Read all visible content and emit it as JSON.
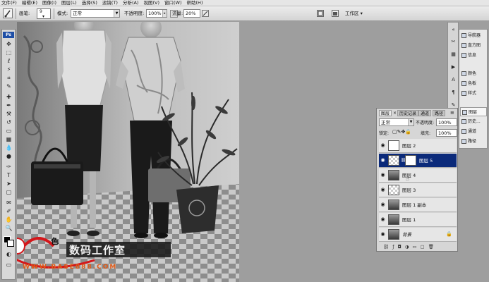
{
  "menu": [
    "文件(F)",
    "编辑(E)",
    "图像(I)",
    "图层(L)",
    "选择(S)",
    "滤镜(T)",
    "分析(A)",
    "视图(V)",
    "窗口(W)",
    "帮助(H)"
  ],
  "options": {
    "brush_label": "画笔:",
    "brush_size": "9",
    "mode_label": "模式:",
    "mode_value": "正常",
    "opacity_label": "不透明度:",
    "opacity_value": "100%",
    "flow_label": "流量:",
    "flow_value": "20%",
    "workspace_label": "工作区"
  },
  "toolbox": {
    "logo": "Ps"
  },
  "nav_panel": {
    "items": [
      "导航器",
      "直方图",
      "信息",
      "颜色",
      "色板",
      "样式",
      "图层",
      "历史...",
      "通道",
      "路径"
    ]
  },
  "layers_panel": {
    "tabs": [
      "图层",
      "历史记录",
      "通道",
      "路径"
    ],
    "close_glyph": "×",
    "blend_mode": "正常",
    "opacity_label": "不透明度:",
    "opacity_value": "100%",
    "lock_label": "锁定:",
    "fill_label": "填充:",
    "fill_value": "100%",
    "layers": [
      "图层 2",
      "图层 5",
      "图层 4",
      "图层 3",
      "图层 1 副本",
      "图层 1",
      "背景"
    ],
    "selected_layer": "图层 5"
  },
  "watermark": {
    "char": "色",
    "studio": "数码工作室",
    "url": "WWW.BASE888.COM"
  },
  "colors": {
    "selection": "#0b2a7a",
    "accent_red": "#d4161a",
    "ps_blue": "#1f4fa6"
  }
}
